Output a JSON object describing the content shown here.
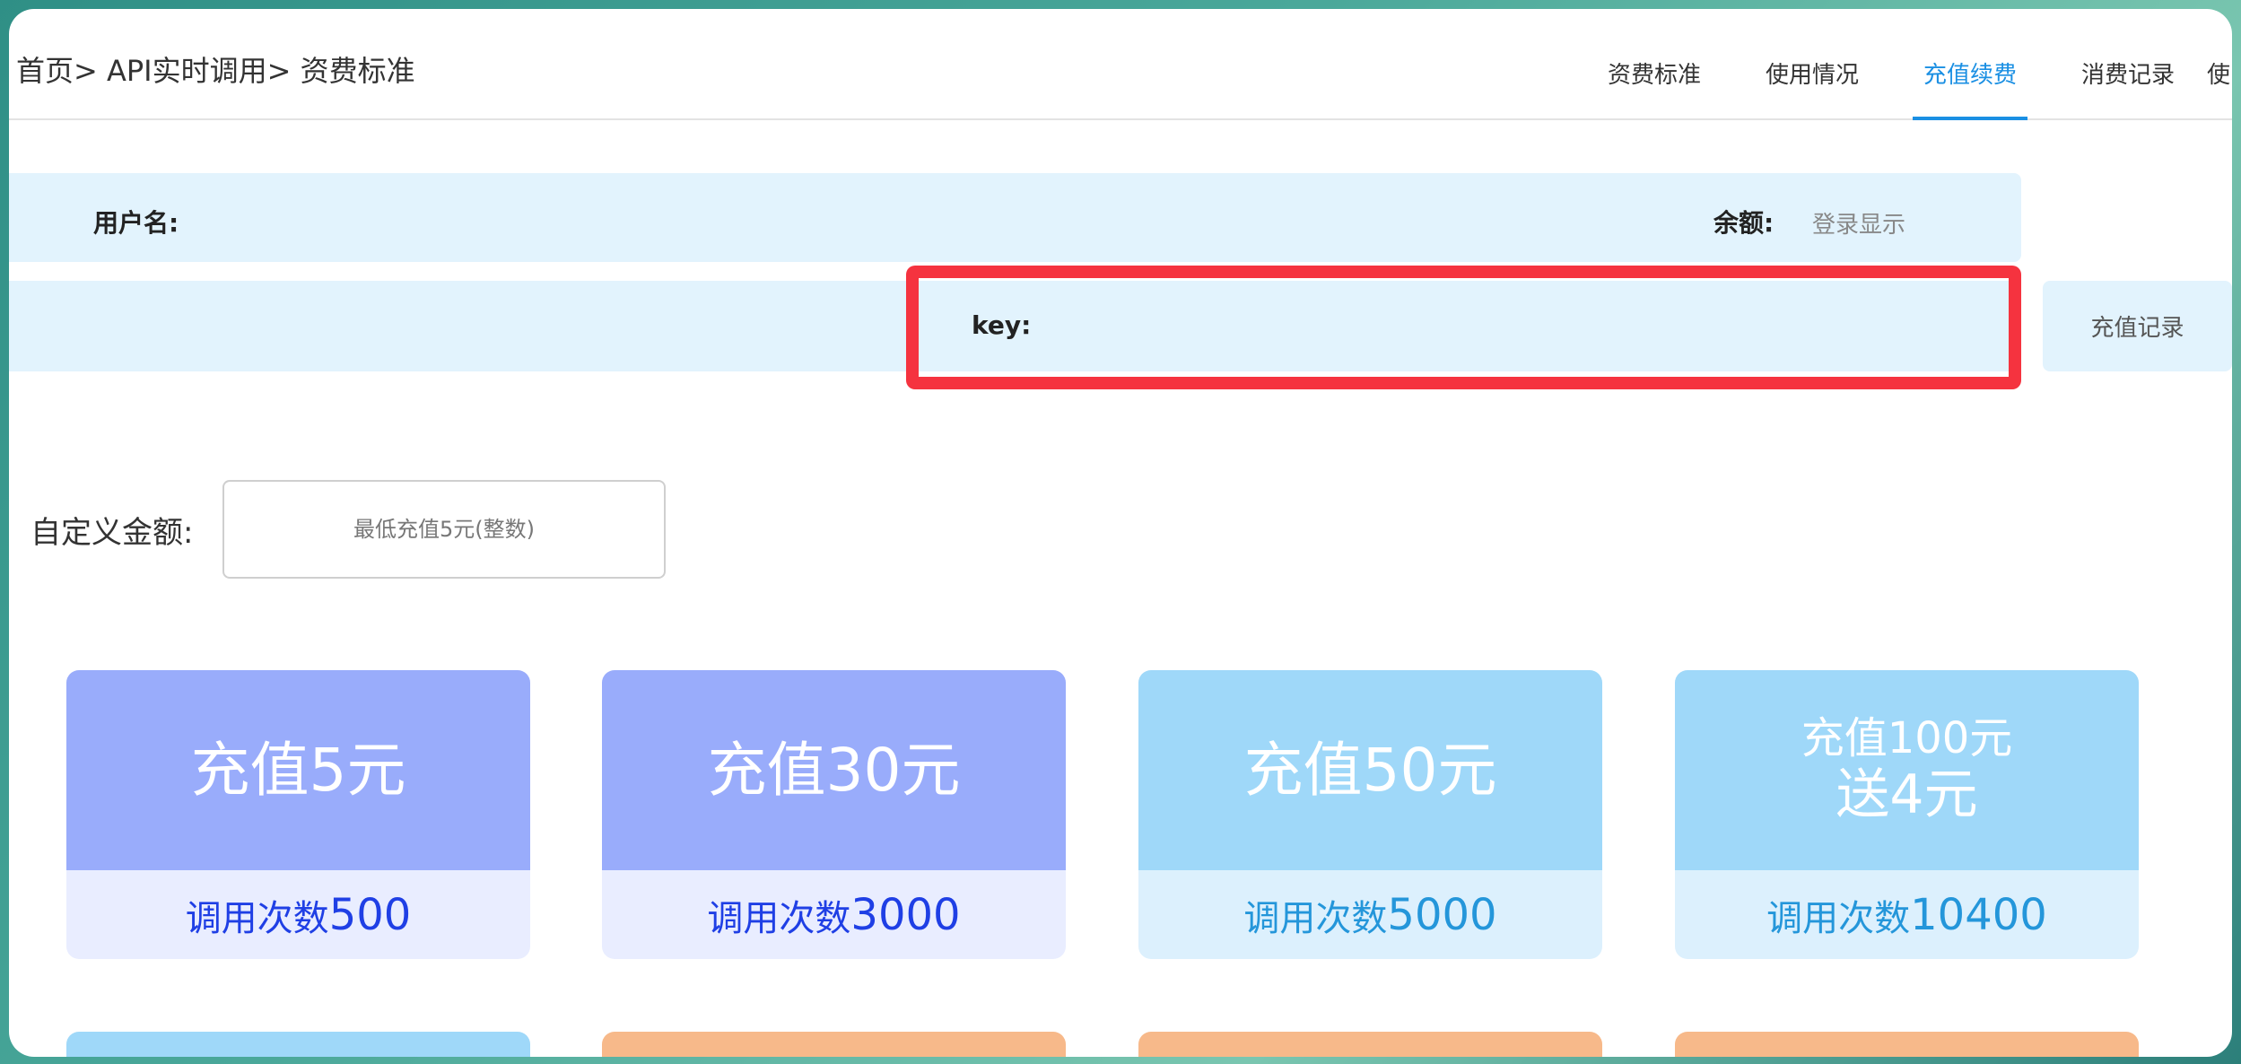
{
  "breadcrumb": "首页> API实时调用> 资费标准",
  "tabs": [
    {
      "label": "资费标准",
      "active": false
    },
    {
      "label": "使用情况",
      "active": false
    },
    {
      "label": "充值续费",
      "active": true
    },
    {
      "label": "消费记录",
      "active": false
    },
    {
      "label": "使",
      "active": false
    }
  ],
  "user": {
    "username_label": "用户名:",
    "balance_label": "余额:",
    "balance_value": "登录显示"
  },
  "key": {
    "label": "key:"
  },
  "recharge_record_button": "充值记录",
  "custom_amount": {
    "label": "自定义金额:",
    "placeholder": "最低充值5元(整数)"
  },
  "packages": [
    {
      "line1": "充值5元",
      "line2": "",
      "calls_label": "调用次数",
      "calls": "500",
      "theme": "purple"
    },
    {
      "line1": "充值30元",
      "line2": "",
      "calls_label": "调用次数",
      "calls": "3000",
      "theme": "purple"
    },
    {
      "line1": "充值50元",
      "line2": "",
      "calls_label": "调用次数",
      "calls": "5000",
      "theme": "blue"
    },
    {
      "line1": "充值100元",
      "line2": "送4元",
      "calls_label": "调用次数",
      "calls": "10400",
      "theme": "blue"
    }
  ],
  "colors": {
    "accent": "#1a8fe3",
    "highlight": "#f5333f",
    "panel": "#e2f3fd",
    "purple_card": "#99acfb",
    "blue_card": "#9fd8f9",
    "orange_card": "#f7b98a"
  }
}
